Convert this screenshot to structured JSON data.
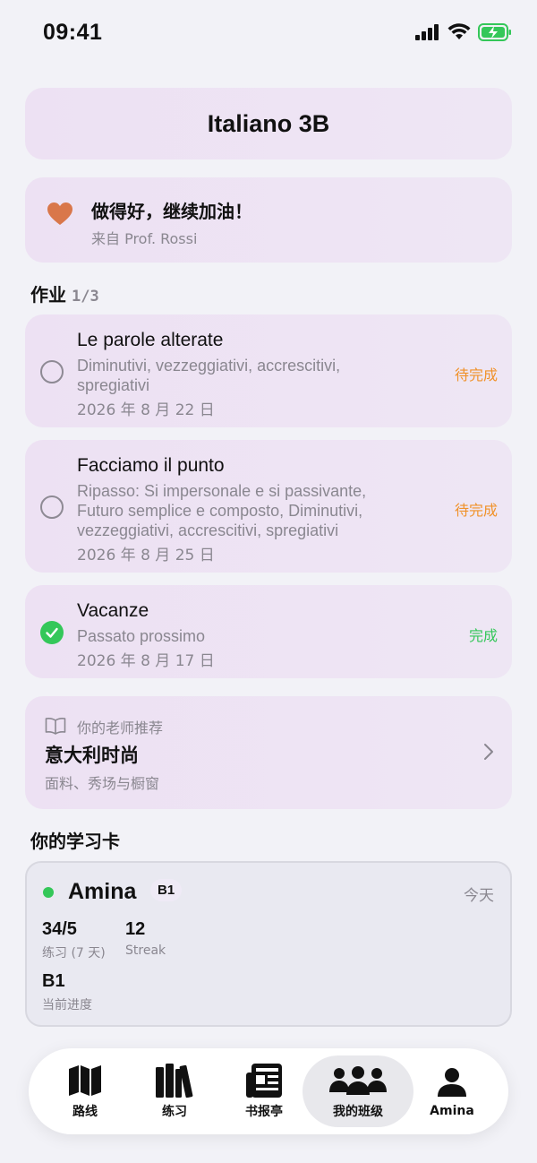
{
  "status_bar": {
    "time": "09:41"
  },
  "class": {
    "title": "Italiano 3B"
  },
  "praise": {
    "message": "做得好，继续加油！",
    "from": "来自 Prof. Rossi",
    "icon": "heart-icon",
    "color": "#d9774a"
  },
  "homework": {
    "title": "作业",
    "count": "1/3",
    "items": [
      {
        "title": "Le parole alterate",
        "desc": "Diminutivi, vezzeggiativi, accrescitivi, spregiativi",
        "date": "2026 年 8 月 22 日",
        "status": "待完成",
        "done": false
      },
      {
        "title": "Facciamo il punto",
        "desc": "Ripasso: Si impersonale e si passivante, Futuro semplice e composto, Diminutivi, vezzeggiativi, accrescitivi, spregiativi",
        "date": "2026 年 8 月 25 日",
        "status": "待完成",
        "done": false
      },
      {
        "title": "Vacanze",
        "desc": "Passato prossimo",
        "date": "2026 年 8 月 17 日",
        "status": "完成",
        "done": true
      }
    ]
  },
  "recommendation": {
    "label": "你的老师推荐",
    "title": "意大利时尚",
    "subtitle": "面料、秀场与橱窗"
  },
  "study_card": {
    "section_title": "你的学习卡",
    "student": "Amina",
    "level": "B1",
    "date": "今天",
    "stats": [
      {
        "value": "34/5",
        "label": "练习 (7 天)"
      },
      {
        "value": "12",
        "label": "Streak"
      },
      {
        "value": "B1",
        "label": "当前进度"
      }
    ]
  },
  "tabs": [
    {
      "label": "路线",
      "icon": "map-icon"
    },
    {
      "label": "练习",
      "icon": "books-icon"
    },
    {
      "label": "书报亭",
      "icon": "newspaper-icon"
    },
    {
      "label": "我的班级",
      "icon": "group-icon",
      "active": true
    },
    {
      "label": "Amina",
      "icon": "person-icon"
    }
  ]
}
